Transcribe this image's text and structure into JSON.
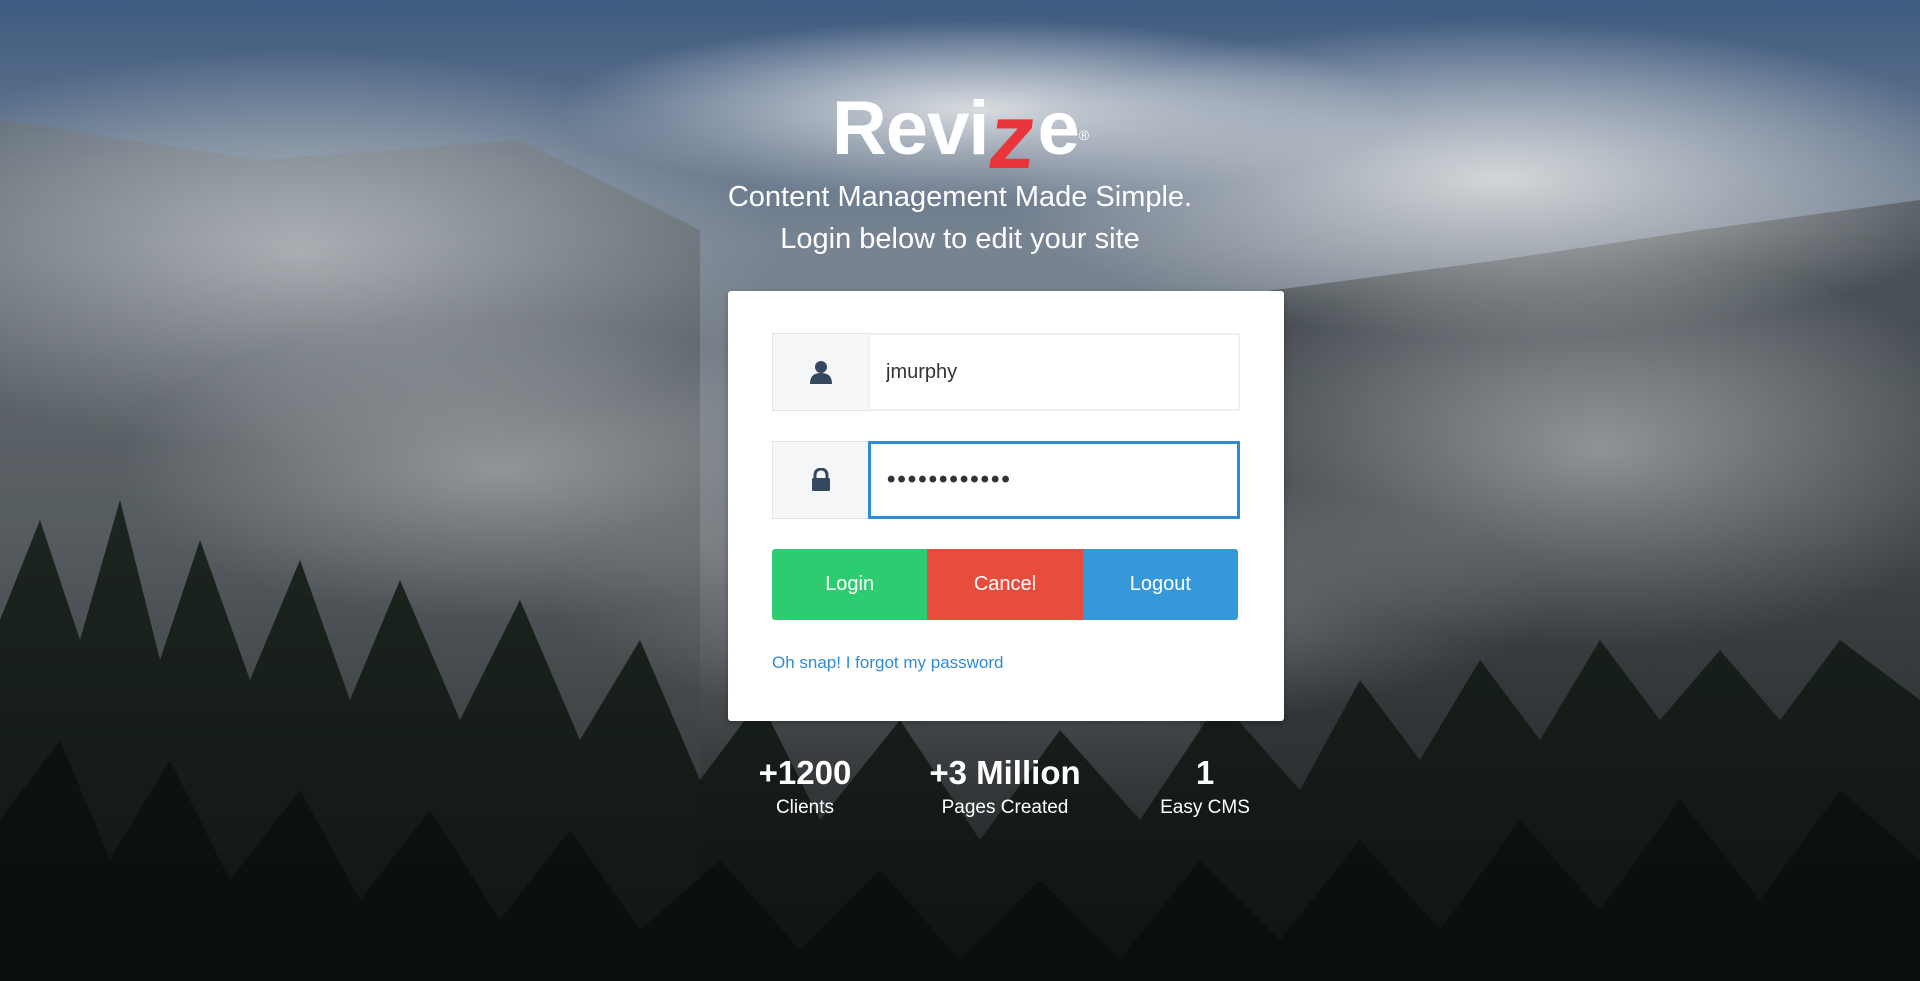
{
  "brand": {
    "logo_part1": "Revi",
    "logo_part2": "z",
    "logo_part3": "e",
    "registered_mark": "®",
    "accent_color": "#e8343a"
  },
  "tagline": {
    "line1": "Content Management Made Simple.",
    "line2": "Login below to edit your site"
  },
  "login_form": {
    "username_icon": "user-icon",
    "username_value": "jmurphy",
    "password_icon": "lock-icon",
    "password_value": "••••••••••••",
    "buttons": {
      "login": "Login",
      "cancel": "Cancel",
      "logout": "Logout"
    },
    "button_colors": {
      "login": "#2ecc71",
      "cancel": "#e74c3c",
      "logout": "#3498db"
    },
    "forgot_link": "Oh snap! I forgot my password"
  },
  "stats": [
    {
      "value": "+1200",
      "label": "Clients"
    },
    {
      "value": "+3 Million",
      "label": "Pages Created"
    },
    {
      "value": "1",
      "label": "Easy CMS"
    }
  ]
}
